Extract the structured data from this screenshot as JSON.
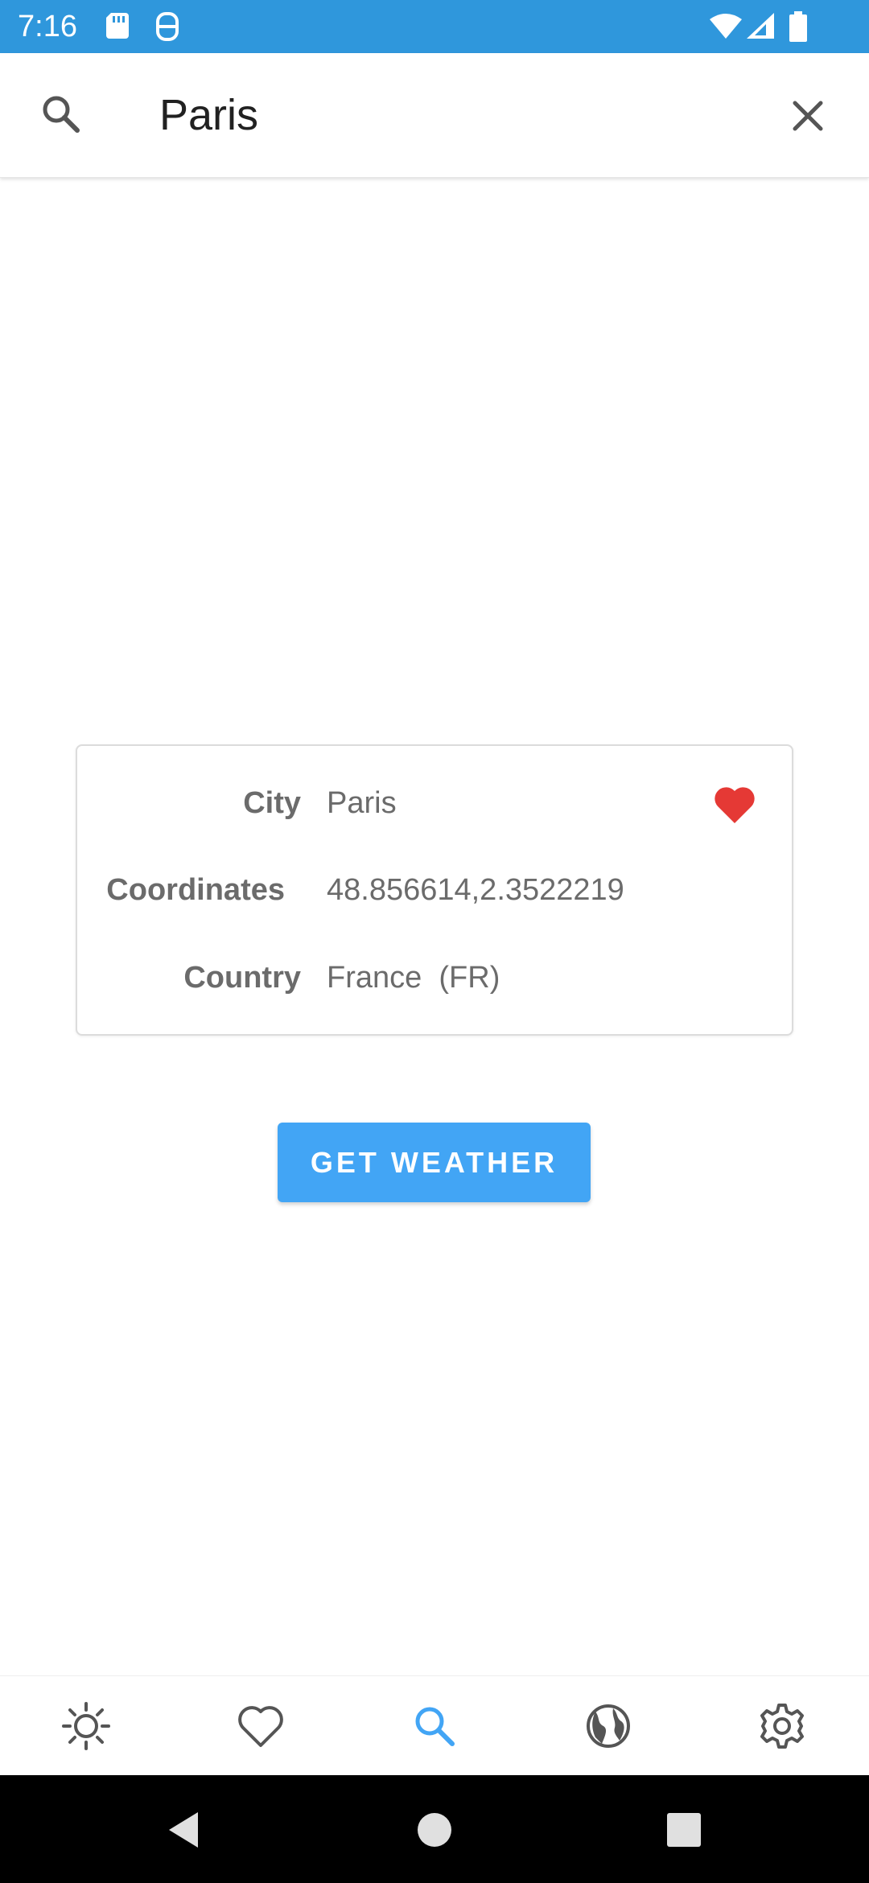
{
  "status_bar": {
    "time": "7:16",
    "icons": [
      "sd-card-icon",
      "vpn-icon",
      "wifi-icon",
      "signal-icon",
      "battery-icon"
    ],
    "background": "#2f97dc"
  },
  "search": {
    "icon": "search-icon",
    "value": "Paris",
    "clear_icon": "close-icon"
  },
  "card": {
    "city_label": "City",
    "city_value": "Paris",
    "coordinates_label": "Coordinates",
    "coordinates_value": "48.856614,2.3522219",
    "country_label": "Country",
    "country_value": "France  (FR)",
    "favorite_icon": "heart-icon",
    "favorite_color": "#e53935"
  },
  "action": {
    "get_weather_label": "GET WEATHER",
    "color": "#42a5f5"
  },
  "bottom_nav": {
    "items": [
      {
        "icon": "sun-icon",
        "active": false
      },
      {
        "icon": "heart-outline-icon",
        "active": false
      },
      {
        "icon": "search-icon",
        "active": true
      },
      {
        "icon": "globe-icon",
        "active": false
      },
      {
        "icon": "gear-icon",
        "active": false
      }
    ],
    "active_color": "#42a5f5",
    "inactive_color": "#555555"
  },
  "system_nav": {
    "icons": [
      "back-icon",
      "home-icon",
      "recents-icon"
    ]
  }
}
